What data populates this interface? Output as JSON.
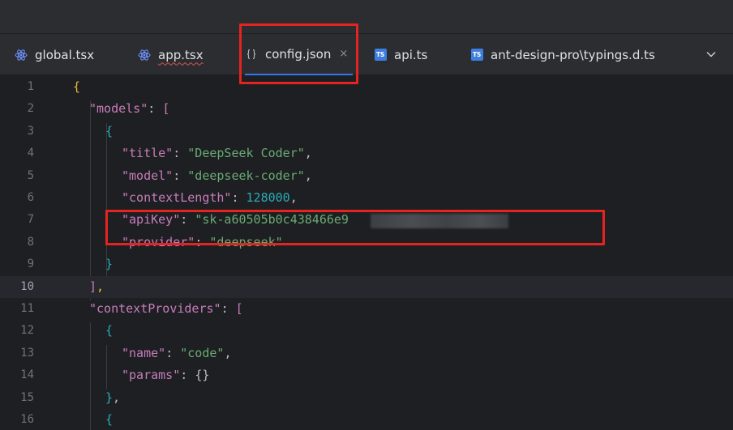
{
  "tabs": [
    {
      "label": "global.tsx",
      "icon": "react-icon"
    },
    {
      "label": "app.tsx",
      "icon": "react-icon"
    },
    {
      "label": "config.json",
      "icon": "json-braces-icon",
      "close": "×"
    },
    {
      "label": "api.ts",
      "icon": "typescript-icon",
      "badge": "TS"
    },
    {
      "label": "ant-design-pro\\typings.d.ts",
      "icon": "typescript-icon",
      "badge": "TS"
    }
  ],
  "editor": {
    "current_line": 10,
    "line_numbers": [
      "1",
      "2",
      "3",
      "4",
      "5",
      "6",
      "7",
      "8",
      "9",
      "10",
      "11",
      "12",
      "13",
      "14",
      "15",
      "16"
    ],
    "code": {
      "models_key": "\"models\"",
      "title_key": "\"title\"",
      "title_val": "\"DeepSeek Coder\"",
      "model_key": "\"model\"",
      "model_val": "\"deepseek-coder\"",
      "context_length_key": "\"contextLength\"",
      "context_length_val": "128000",
      "api_key_key": "\"apiKey\"",
      "api_key_val": "\"sk-a60505b0c438466e9",
      "provider_key": "\"provider\"",
      "provider_val": "\"deepseek\"",
      "context_providers_key": "\"contextProviders\"",
      "name_key": "\"name\"",
      "name_val": "\"code\"",
      "params_key": "\"params\"",
      "params_val": "{}"
    }
  },
  "colors": {
    "highlight_box": "#e5231f",
    "active_tab_underline": "#3574f0",
    "string": "#6aab73",
    "key": "#c77dbb",
    "number": "#2aacb8"
  }
}
